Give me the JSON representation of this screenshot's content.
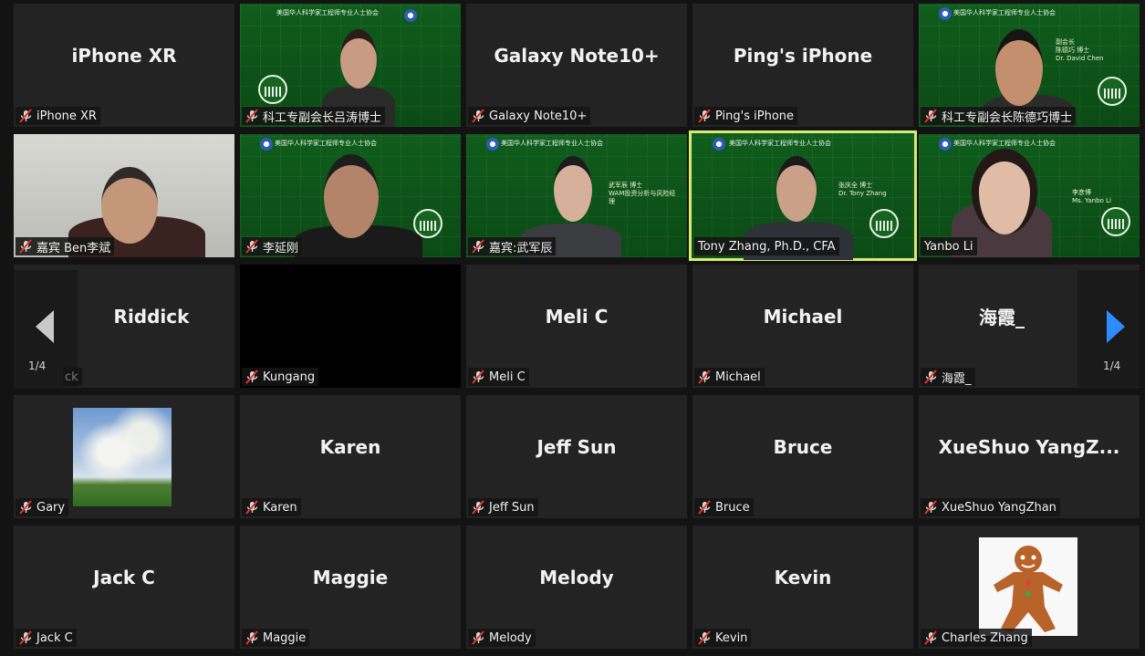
{
  "pagination": {
    "left": "1/4",
    "right": "1/4"
  },
  "row1": {
    "t1": {
      "name": "iPhone XR",
      "label": "iPhone XR"
    },
    "t2": {
      "label": "科工专副会长吕涛博士",
      "banner": "美国华人科学家工程师专业人士协会"
    },
    "t3": {
      "name": "Galaxy Note10+",
      "label": "Galaxy Note10+"
    },
    "t4": {
      "name": "Ping's iPhone",
      "label": "Ping's iPhone"
    },
    "t5": {
      "label": "科工专副会长陈德巧博士",
      "banner": "美国华人科学家工程师专业人士协会",
      "note": "副会长\n陈德巧 博士\nDr. David Chen"
    }
  },
  "row2": {
    "t1": {
      "label": "嘉宾 Ben李斌"
    },
    "t2": {
      "label": "李延刚",
      "banner": "美国华人科学家工程师专业人士协会"
    },
    "t3": {
      "label": "嘉宾:武军辰",
      "banner": "美国华人科学家工程师专业人士协会",
      "note": "武军辰 博士\nWAM投资分析与风险经理"
    },
    "t4": {
      "label": "Tony Zhang, Ph.D., CFA",
      "banner": "美国华人科学家工程师专业人士协会",
      "note": "张庆全 博士\nDr. Tony Zhang"
    },
    "t5": {
      "label": "Yanbo Li",
      "banner": "美国华人科学家工程师专业人士协会",
      "note": "李彦博\nMs. Yanbo Li"
    }
  },
  "row3": {
    "t1": {
      "name": "Riddick",
      "label": "ck"
    },
    "t2": {
      "label": "Kungang"
    },
    "t3": {
      "name": "Meli C",
      "label": "Meli C"
    },
    "t4": {
      "name": "Michael",
      "label": "Michael"
    },
    "t5": {
      "name": "海霞_",
      "label": "海霞_"
    }
  },
  "row4": {
    "t1": {
      "label": "Gary"
    },
    "t2": {
      "name": "Karen",
      "label": "Karen"
    },
    "t3": {
      "name": "Jeff Sun",
      "label": "Jeff Sun"
    },
    "t4": {
      "name": "Bruce",
      "label": "Bruce"
    },
    "t5": {
      "name": "XueShuo  YangZ...",
      "label": "XueShuo YangZhan"
    }
  },
  "row5": {
    "t1": {
      "name": "Jack C",
      "label": "Jack C"
    },
    "t2": {
      "name": "Maggie",
      "label": "Maggie"
    },
    "t3": {
      "name": "Melody",
      "label": "Melody"
    },
    "t4": {
      "name": "Kevin",
      "label": "Kevin"
    },
    "t5": {
      "label": "Charles Zhang"
    }
  },
  "colors": {
    "active_border": "#d7ea72",
    "arrow_active": "#2d8cff",
    "muted_mic": "#e0352b"
  }
}
